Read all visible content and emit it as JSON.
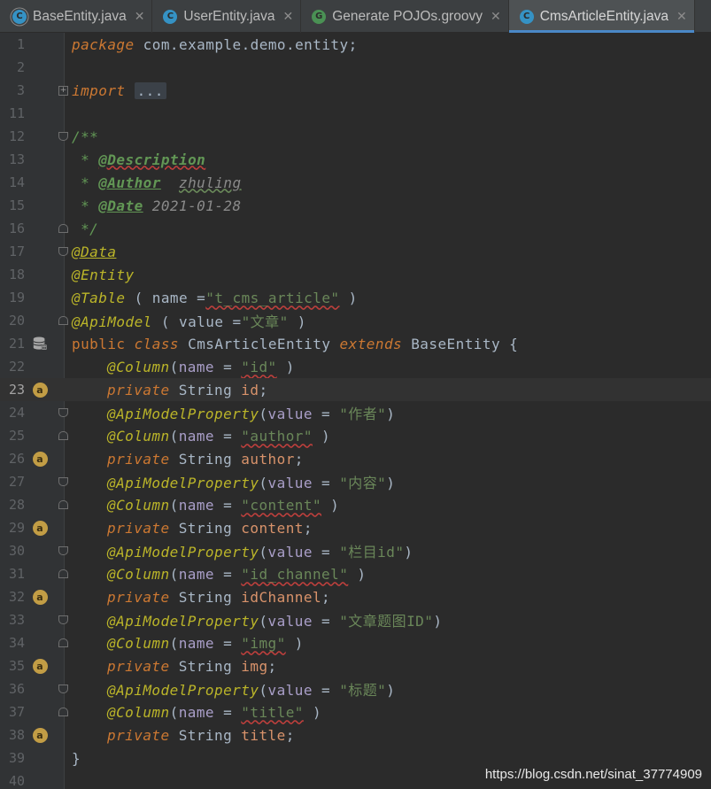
{
  "tabs": [
    {
      "label": "BaseEntity.java",
      "icon": "abstract-class-icon",
      "active": false
    },
    {
      "label": "UserEntity.java",
      "icon": "class-icon",
      "active": false
    },
    {
      "label": "Generate POJOs.groovy",
      "icon": "groovy-script-icon",
      "active": false
    },
    {
      "label": "CmsArticleEntity.java",
      "icon": "class-icon",
      "active": true
    }
  ],
  "tab_icon_letters": {
    "class": "C",
    "groovy": "G"
  },
  "close_glyph": "✕",
  "lines": {
    "n1": "1",
    "n2": "2",
    "n3": "3",
    "n11": "11",
    "n12": "12",
    "n13": "13",
    "n14": "14",
    "n15": "15",
    "n16": "16",
    "n17": "17",
    "n18": "18",
    "n19": "19",
    "n20": "20",
    "n21": "21",
    "n22": "22",
    "n23": "23",
    "n24": "24",
    "n25": "25",
    "n26": "26",
    "n27": "27",
    "n28": "28",
    "n29": "29",
    "n30": "30",
    "n31": "31",
    "n32": "32",
    "n33": "33",
    "n34": "34",
    "n35": "35",
    "n36": "36",
    "n37": "37",
    "n38": "38",
    "n39": "39",
    "n40": "40"
  },
  "code": {
    "package_kw": "package",
    "package_name": " com.example.demo.entity;",
    "import_kw": "import",
    "import_ellipsis": "...",
    "doc_open": "/**",
    "doc_star": " * ",
    "doc_desc": "@Description",
    "doc_author": "@Author",
    "doc_author_name": "zhuling",
    "doc_date": "@Date",
    "doc_date_value": " 2021-01-28",
    "doc_close": " */",
    "anno_data": "@Data",
    "anno_entity": "@Entity",
    "anno_table": "@Table",
    "anno_table_args_open": " ( ",
    "anno_table_name": "name",
    "anno_table_eq": " =",
    "anno_table_value": "\"t_cms_article\"",
    "anno_table_close": " )",
    "anno_apimodel": "@ApiModel",
    "anno_apimodel_open": " ( ",
    "anno_apimodel_key": "value",
    "anno_apimodel_eq": " =",
    "anno_apimodel_value": "\"文章\"",
    "anno_apimodel_close": " )",
    "class_public": "public",
    "class_kw": "class",
    "class_name": "CmsArticleEntity",
    "class_extends": "extends",
    "class_parent": "BaseEntity",
    "class_brace": " {",
    "closing_brace": "}",
    "col": "@Column",
    "api": "@ApiModelProperty",
    "name_key": "name",
    "value_key": "value",
    "private_kw": "private",
    "string_type": "String",
    "fields": [
      {
        "column": "\"id\"",
        "field": "id",
        "api_value": null
      },
      {
        "column": "\"author\"",
        "field": "author",
        "api_value": "\"作者\""
      },
      {
        "column": "\"content\"",
        "field": "content",
        "api_value": "\"内容\""
      },
      {
        "column": "\"id_channel\"",
        "field": "idChannel",
        "api_value": "\"栏目id\""
      },
      {
        "column": "\"img\"",
        "field": "img",
        "api_value": "\"文章题图ID\""
      },
      {
        "column": "\"title\"",
        "field": "title",
        "api_value": "\"标题\""
      }
    ]
  },
  "gutter_badge_letter": "a",
  "watermark": "https://blog.csdn.net/sinat_37774909",
  "colors": {
    "background": "#2b2b2b",
    "gutter": "#313335",
    "keyword": "#cc7832",
    "annotation": "#bbb529",
    "string": "#6a8759",
    "doc_comment": "#629755",
    "active_tab_underline": "#4a88c7"
  }
}
